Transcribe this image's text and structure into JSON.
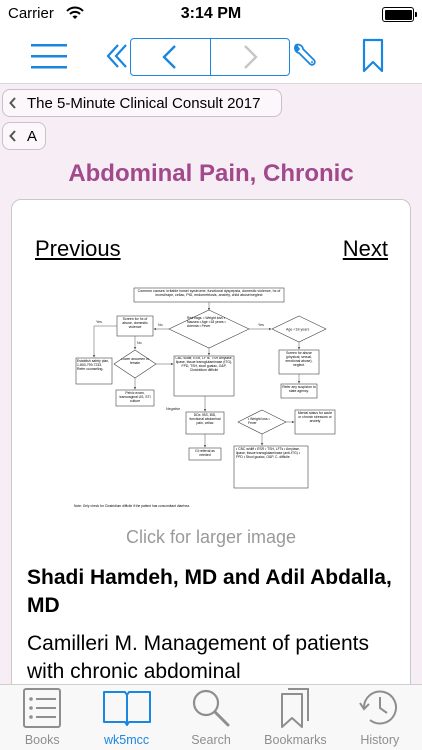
{
  "status_bar": {
    "carrier": "Carrier",
    "time": "3:14 PM"
  },
  "breadcrumbs": [
    {
      "label": "The 5-Minute Clinical Consult 2017"
    },
    {
      "label": "A"
    }
  ],
  "page_title": "Abdominal Pain, Chronic",
  "card": {
    "previous_label": "Previous",
    "next_label": "Next",
    "larger_image_label": "Click for larger image",
    "authors": "Shadi Hamdeh, MD and Adil Abdalla, MD",
    "reference_text": "Camilleri M. Management of patients with chronic abdominal"
  },
  "flowchart": {
    "common_causes": "Common causes: irritable bowel syndrome, functional dyspepsia, domestic violence, hx of incest/rape, celiac, PID, endometriosis, anxiety, child abuse/neglect",
    "red_flags": "Red flags: • Weight loss • Nausea • Age >18 years • Anemia • Fever",
    "screen_abuse": "Screen for hx of abuse, domestic violence",
    "age_18": "Age <18 years",
    "safety_plan": "Establish safety plan, 1-800-799-7233. Refer counseling.",
    "lower_abdomen": "Lower abdomen of female",
    "cbc_workup": "CBC w/diff, ESR, LFTs, TSH amylase, lipase, tissue transglutaminase (tTG), FPD, TSH, stool guaiac, O&P, Clostridium difficile",
    "screen_physical": "Screen for abuse (physical, sexual, emotional abuse), neglect.",
    "pelvic_exam": "Pelvic exam, transvaginal US, STI culture",
    "refer_authority": "Refer any suspicion to state agency.",
    "ddx": "DDx: IBS, IBD, functional abdominal pain, celiac",
    "weight_loss_fever": "• Weight loss • Fever",
    "mental_status": "Mental status for acute or chronic stressors or anxiety",
    "gi_referral": "GI referral as needed",
    "workup_list": "• CBC w/diff • ESR • TSH, LFTs • Amylase, lipase, tissue transglutaminase (anti-tTG) • FPD • Stool guaiac, O&P, C. difficile",
    "yes": "Yes",
    "no": "No",
    "negative": "Negative",
    "note": "Note: Only check for Clostridium difficile if the patient has concomitant diarrhea."
  },
  "tabs": [
    {
      "label": "Books",
      "icon": "books-list-icon",
      "active": false
    },
    {
      "label": "wk5mcc",
      "icon": "open-book-icon",
      "active": true
    },
    {
      "label": "Search",
      "icon": "magnifier-icon",
      "active": false
    },
    {
      "label": "Bookmarks",
      "icon": "bookmarks-icon",
      "active": false
    },
    {
      "label": "History",
      "icon": "clock-icon",
      "active": false
    }
  ],
  "colors": {
    "accent": "#1a86e0",
    "title": "#a2498c",
    "background": "#f7eef5",
    "muted": "#9a9a9a"
  }
}
